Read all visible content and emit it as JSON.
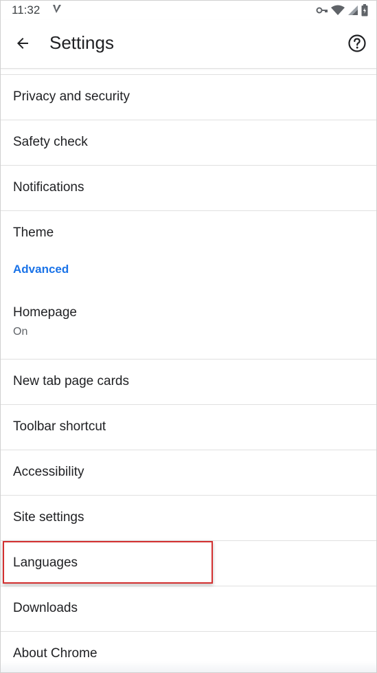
{
  "status_bar": {
    "time": "11:32"
  },
  "app_bar": {
    "title": "Settings"
  },
  "settings": {
    "privacy": "Privacy and security",
    "safety": "Safety check",
    "notifications": "Notifications",
    "theme": "Theme",
    "advanced_header": "Advanced",
    "homepage": "Homepage",
    "homepage_status": "On",
    "new_tab": "New tab page cards",
    "toolbar_shortcut": "Toolbar shortcut",
    "accessibility": "Accessibility",
    "site_settings": "Site settings",
    "languages": "Languages",
    "downloads": "Downloads",
    "about": "About Chrome"
  },
  "colors": {
    "accent": "#1a73e8",
    "highlight": "#d32f2f"
  }
}
